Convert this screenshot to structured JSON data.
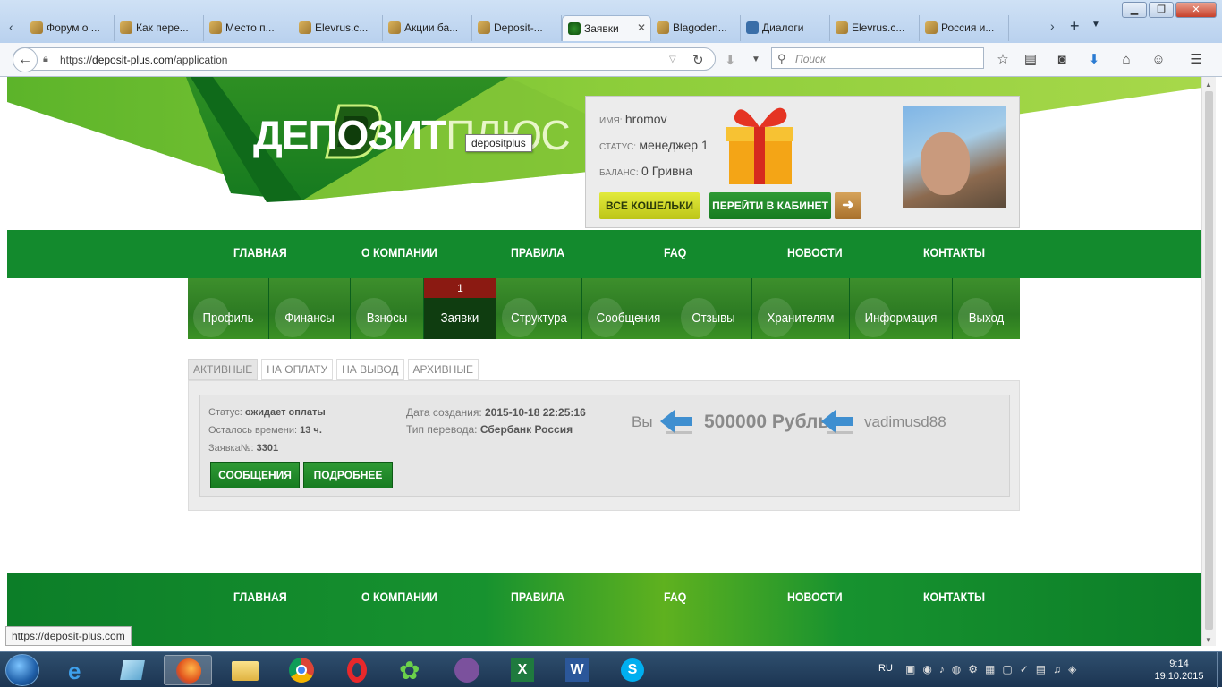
{
  "browser": {
    "tabs": [
      {
        "label": "Форум о ...",
        "active": false
      },
      {
        "label": "Как пере...",
        "active": false
      },
      {
        "label": "Место п...",
        "active": false
      },
      {
        "label": "Elevrus.c...",
        "active": false
      },
      {
        "label": "Акции ба...",
        "active": false
      },
      {
        "label": "Deposit-...",
        "active": false
      },
      {
        "label": "Заявки",
        "active": true
      },
      {
        "label": "Blagoden...",
        "active": false
      },
      {
        "label": "Диалоги",
        "active": false
      },
      {
        "label": "Elevrus.c...",
        "active": false
      },
      {
        "label": "Россия и...",
        "active": false
      }
    ],
    "url_prefix": "https://",
    "url_host": "deposit-plus.com",
    "url_path": "/application",
    "search_placeholder": "Поиск",
    "status_url": "https://deposit-plus.com"
  },
  "site": {
    "logo_bold": "ДЕПОЗИТ",
    "logo_thin": "ПЛЮС",
    "tooltip": "depositplus",
    "user": {
      "name_label": "имя:",
      "name": "hromov",
      "status_label": "статус:",
      "status": "менеджер 1",
      "balance_label": "баланс:",
      "balance": "0 Гривна",
      "wallets_button": "ВСЕ КОШЕЛЬКИ",
      "cabinet_button": "ПЕРЕЙТИ В КАБИНЕТ"
    },
    "main_nav": [
      "ГЛАВНАЯ",
      "О КОМПАНИИ",
      "ПРАВИЛА",
      "FAQ",
      "НОВОСТИ",
      "КОНТАКТЫ"
    ],
    "sub_nav": [
      "Профиль",
      "Финансы",
      "Взносы",
      "Заявки",
      "Структура",
      "Сообщения",
      "Отзывы",
      "Хранителям",
      "Информация",
      "Выход"
    ],
    "sub_nav_active": "Заявки",
    "badge_count": "1",
    "filter_tabs": [
      "АКТИВНЫЕ",
      "НА ОПЛАТУ",
      "НА ВЫВОД",
      "АРХИВНЫЕ"
    ],
    "application": {
      "status_label": "Статус:",
      "status": "ожидает оплаты",
      "time_left_label": "Осталось времени:",
      "time_left": "13 ч.",
      "number_label": "Заявка№:",
      "number": "3301",
      "created_label": "Дата создания:",
      "created": "2015-10-18 22:25:16",
      "transfer_label": "Тип перевода:",
      "transfer": "Сбербанк Россия",
      "from": "Вы",
      "amount": "500000 Рубль",
      "to": "vadimusd88",
      "messages_button": "СООБЩЕНИЯ",
      "details_button": "ПОДРОБНЕЕ"
    }
  },
  "taskbar": {
    "lang": "RU",
    "time": "9:14",
    "date": "19.10.2015"
  },
  "colors": {
    "nav_green": "#138a2d",
    "badge_red": "#8b1a12",
    "yellow_button": "#c8d420",
    "arrow_blue": "#3f8fd0"
  }
}
